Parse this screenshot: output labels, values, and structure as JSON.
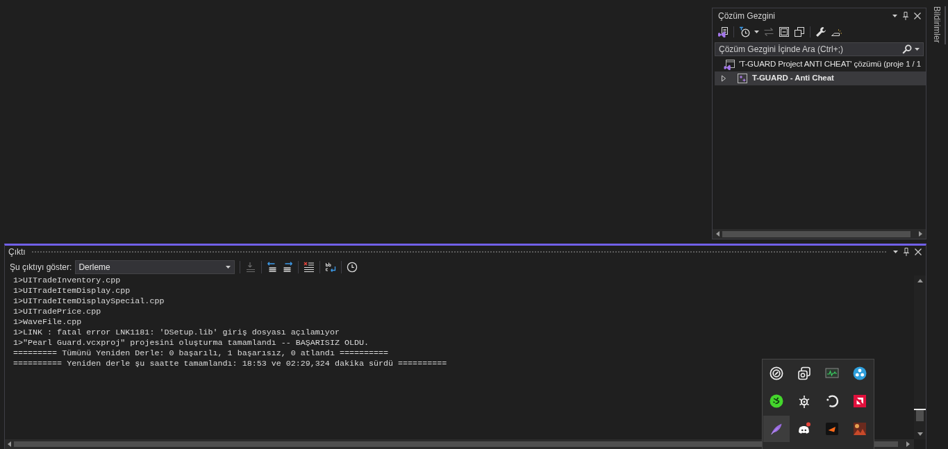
{
  "solution_explorer": {
    "title": "Çözüm Gezgini",
    "toolbar": [
      [
        {
          "kind": "properties",
          "disabled": false
        }
      ],
      [
        {
          "kind": "history",
          "disabled": false
        },
        {
          "kind": "sync",
          "disabled": true
        },
        {
          "kind": "collapse_all",
          "disabled": false
        },
        {
          "kind": "copy",
          "disabled": false
        }
      ],
      [
        {
          "kind": "settings",
          "disabled": false
        },
        {
          "kind": "preview",
          "disabled": false
        }
      ]
    ],
    "search": {
      "placeholder": "Çözüm Gezgini İçinde Ara (Ctrl+;)"
    },
    "tree": [
      {
        "kind": "solution",
        "label": "'T-GUARD Project ANTI CHEAT' çözümü (proje 1 / 1",
        "selected": false,
        "startup": false,
        "children": [
          {
            "kind": "project",
            "label": "T-GUARD - Anti Cheat",
            "selected": true,
            "startup": true,
            "expanded": false
          }
        ]
      }
    ]
  },
  "side_tab": {
    "label": "Bildirimler"
  },
  "output": {
    "title": "Çıktı",
    "source_label": "Şu çıktıyı göster:",
    "source": {
      "value": "Derleme"
    },
    "toolbar": [
      [
        {
          "kind": "go_to",
          "disabled": true
        }
      ],
      [
        {
          "kind": "previous",
          "disabled": false
        },
        {
          "kind": "next",
          "disabled": false
        }
      ],
      [
        {
          "kind": "clear",
          "disabled": false
        }
      ],
      [
        {
          "kind": "word_wrap",
          "disabled": false
        }
      ],
      [
        {
          "kind": "timestamps",
          "disabled": false
        }
      ]
    ],
    "lines": [
      "1>UITradeInventory.cpp",
      "1>UITradeItemDisplay.cpp",
      "1>UITradeItemDisplaySpecial.cpp",
      "1>UITradePrice.cpp",
      "1>WaveFile.cpp",
      "1>LINK : fatal error LNK1181: 'DSetup.lib' giriş dosyası açılamıyor",
      "1>\"Pearl Guard.vcxproj\" projesini oluşturma tamamlandı -- BAŞARISIZ OLDU.",
      "========= Tümünü Yeniden Derle: 0 başarılı, 1 başarısız, 0 atlandı ==========",
      "========== Yeniden derle şu saatte tamamlandı: 18:53 ve 02:29,324 dakika sürdü =========="
    ]
  },
  "tray": [
    {
      "kind": "ring",
      "hovered": false
    },
    {
      "kind": "overlapping_squares",
      "hovered": false
    },
    {
      "kind": "monitor_chart",
      "hovered": false
    },
    {
      "kind": "circle_dots",
      "hovered": false
    },
    {
      "kind": "circle_squiggle",
      "hovered": false
    },
    {
      "kind": "gear",
      "hovered": false
    },
    {
      "kind": "arc",
      "hovered": false
    },
    {
      "kind": "red_tile",
      "hovered": false
    },
    {
      "kind": "feather",
      "hovered": true
    },
    {
      "kind": "gamepad",
      "hovered": false
    },
    {
      "kind": "arrow_tile",
      "hovered": false
    },
    {
      "kind": "picture_tile",
      "hovered": false
    }
  ]
}
